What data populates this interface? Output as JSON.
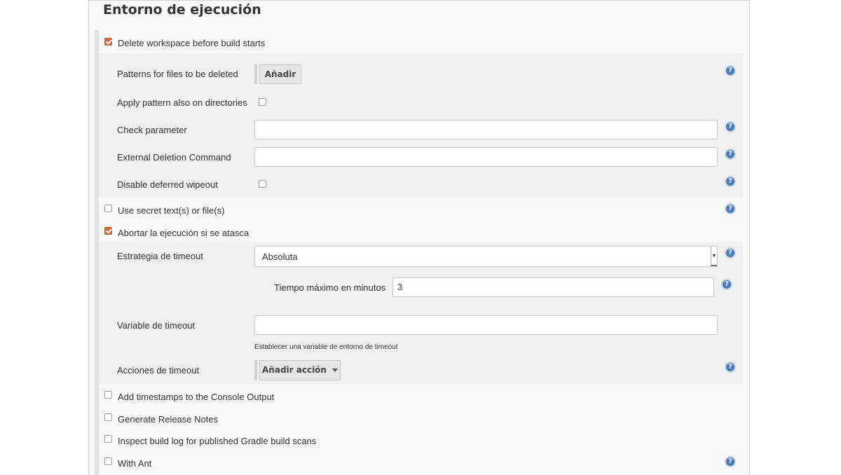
{
  "section": {
    "title": "Entorno de ejecución"
  },
  "workspace": {
    "delete_label": "Delete workspace before build starts",
    "patterns_label": "Patterns for files to be deleted",
    "add_button": "Añadir",
    "apply_dirs_label": "Apply pattern also on directories",
    "check_param_label": "Check parameter",
    "check_param_value": "",
    "external_cmd_label": "External Deletion Command",
    "external_cmd_value": "",
    "disable_wipeout_label": "Disable deferred wipeout"
  },
  "secret": {
    "label": "Use secret text(s) or file(s)"
  },
  "abort": {
    "label": "Abortar la ejecución si se atasca",
    "strategy_label": "Estrategia de timeout",
    "strategy_value": "Absoluta",
    "max_minutes_label": "Tiempo máximo en minutos",
    "max_minutes_value": "3",
    "variable_label": "Variable de timeout",
    "variable_value": "",
    "variable_hint": "Establecer una variable de entorno de timeout",
    "actions_label": "Acciones de timeout",
    "add_action_button": "Añadir acción"
  },
  "options": {
    "timestamps": "Add timestamps to the Console Output",
    "release_notes": "Generate Release Notes",
    "gradle_scans": "Inspect build log for published Gradle build scans",
    "with_ant": "With Ant"
  },
  "icons": {
    "help": "help-icon",
    "checkbox_checked": "checkbox-checked-icon"
  },
  "colors": {
    "accent": "#d16a3a",
    "help": "#4a7ab8"
  }
}
